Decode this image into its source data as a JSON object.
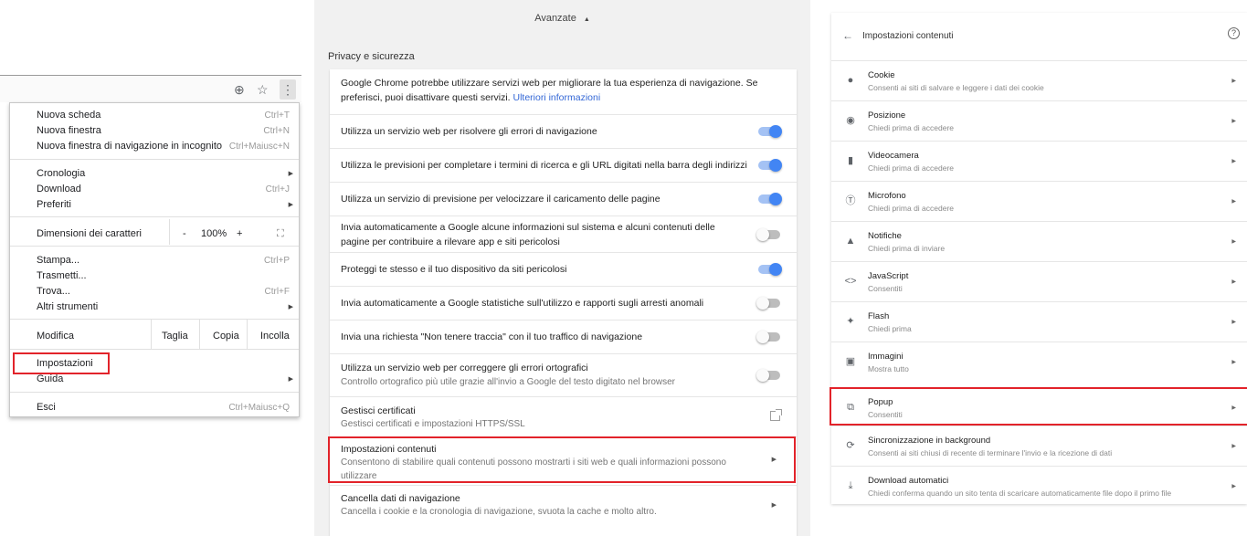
{
  "menu": {
    "items": [
      {
        "label": "Nuova scheda",
        "shortcut": "Ctrl+T"
      },
      {
        "label": "Nuova finestra",
        "shortcut": "Ctrl+N"
      },
      {
        "label": "Nuova finestra di navigazione in incognito",
        "shortcut": "Ctrl+Maiusc+N"
      },
      {
        "label": "Cronologia",
        "shortcut": ""
      },
      {
        "label": "Download",
        "shortcut": "Ctrl+J"
      },
      {
        "label": "Preferiti",
        "shortcut": ""
      },
      {
        "label": "Stampa...",
        "shortcut": "Ctrl+P"
      },
      {
        "label": "Trasmetti...",
        "shortcut": ""
      },
      {
        "label": "Trova...",
        "shortcut": "Ctrl+F"
      },
      {
        "label": "Altri strumenti",
        "shortcut": ""
      },
      {
        "label": "Impostazioni",
        "shortcut": ""
      },
      {
        "label": "Guida",
        "shortcut": ""
      },
      {
        "label": "Esci",
        "shortcut": "Ctrl+Maiusc+Q"
      }
    ],
    "zoom": {
      "label": "Dimensioni dei caratteri",
      "minus": "-",
      "value": "100%",
      "plus": "+"
    },
    "edit": {
      "label": "Modifica",
      "cut": "Taglia",
      "copy": "Copia",
      "paste": "Incolla"
    }
  },
  "settings": {
    "header": "Avanzate",
    "section": "Privacy e sicurezza",
    "intro": {
      "text": "Google Chrome potrebbe utilizzare servizi web per migliorare la tua esperienza di navigazione. Se preferisci, puoi disattivare questi servizi.",
      "link": "Ulteriori informazioni"
    },
    "toggles": [
      {
        "label": "Utilizza un servizio web per risolvere gli errori di navigazione",
        "on": true
      },
      {
        "label": "Utilizza le previsioni per completare i termini di ricerca e gli URL digitati nella barra degli indirizzi",
        "on": true
      },
      {
        "label": "Utilizza un servizio di previsione per velocizzare il caricamento delle pagine",
        "on": true
      },
      {
        "label": "Invia automaticamente a Google alcune informazioni sul sistema e alcuni contenuti delle pagine per contribuire a rilevare app e siti pericolosi",
        "on": false
      },
      {
        "label": "Proteggi te stesso e il tuo dispositivo da siti pericolosi",
        "on": true
      },
      {
        "label": "Invia automaticamente a Google statistiche sull'utilizzo e rapporti sugli arresti anomali",
        "on": false
      },
      {
        "label": "Invia una richiesta \"Non tenere traccia\" con il tuo traffico di navigazione",
        "on": false
      }
    ],
    "spell": {
      "title": "Utilizza un servizio web per correggere gli errori ortografici",
      "sub": "Controllo ortografico più utile grazie all'invio a Google del testo digitato nel browser",
      "on": false
    },
    "certs": {
      "title": "Gestisci certificati",
      "sub": "Gestisci certificati e impostazioni HTTPS/SSL"
    },
    "content": {
      "title": "Impostazioni contenuti",
      "sub": "Consentono di stabilire quali contenuti possono mostrarti i siti web e quali informazioni possono utilizzare"
    },
    "clear": {
      "title": "Cancella dati di navigazione",
      "sub": "Cancella i cookie e la cronologia di navigazione, svuota la cache e molto altro."
    }
  },
  "content_settings": {
    "title": "Impostazioni contenuti",
    "items": [
      {
        "title": "Cookie",
        "sub": "Consenti ai siti di salvare e leggere i dati dei cookie",
        "icon": "cookie-icon"
      },
      {
        "title": "Posizione",
        "sub": "Chiedi prima di accedere",
        "icon": "location-icon"
      },
      {
        "title": "Videocamera",
        "sub": "Chiedi prima di accedere",
        "icon": "camera-icon"
      },
      {
        "title": "Microfono",
        "sub": "Chiedi prima di accedere",
        "icon": "microphone-icon"
      },
      {
        "title": "Notifiche",
        "sub": "Chiedi prima di inviare",
        "icon": "bell-icon"
      },
      {
        "title": "JavaScript",
        "sub": "Consentiti",
        "icon": "code-icon"
      },
      {
        "title": "Flash",
        "sub": "Chiedi prima",
        "icon": "puzzle-icon"
      },
      {
        "title": "Immagini",
        "sub": "Mostra tutto",
        "icon": "image-icon"
      },
      {
        "title": "Popup",
        "sub": "Consentiti",
        "icon": "popup-icon"
      },
      {
        "title": "Sincronizzazione in background",
        "sub": "Consenti ai siti chiusi di recente di terminare l'invio e la ricezione di dati",
        "icon": "sync-icon"
      },
      {
        "title": "Download automatici",
        "sub": "Chiedi conferma quando un sito tenta di scaricare automaticamente file dopo il primo file",
        "icon": "download-icon"
      }
    ]
  },
  "colors": {
    "highlight": "#e2232a",
    "toggle_on": "#4285f4",
    "link": "#3367d6"
  }
}
